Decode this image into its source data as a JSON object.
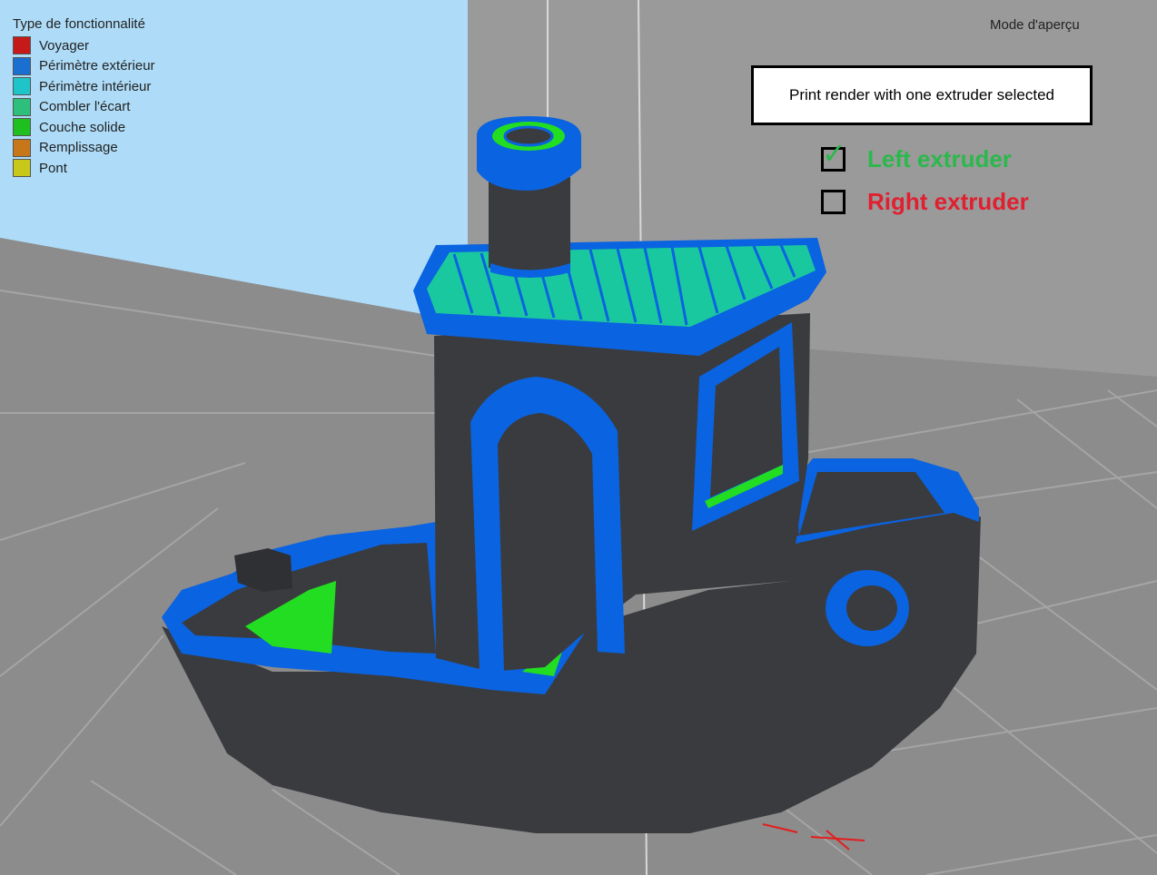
{
  "legend": {
    "title": "Type de fonctionnalité",
    "items": [
      {
        "label": "Voyager",
        "color": "#c41a1a"
      },
      {
        "label": "Périmètre extérieur",
        "color": "#1a6fd0"
      },
      {
        "label": "Périmètre intérieur",
        "color": "#1fc4c8"
      },
      {
        "label": "Combler l'écart",
        "color": "#2fbf7c"
      },
      {
        "label": "Couche solide",
        "color": "#1fbf1f"
      },
      {
        "label": "Remplissage",
        "color": "#c8761a"
      },
      {
        "label": "Pont",
        "color": "#c8c81a"
      }
    ]
  },
  "mode_label": "Mode d'aperçu",
  "annotation": {
    "note": "Print render with one extruder selected",
    "extruders": [
      {
        "label": "Left extruder",
        "checked": true,
        "color": "#2bb84c"
      },
      {
        "label": "Right extruder",
        "checked": false,
        "color": "#e02030"
      }
    ]
  },
  "model": {
    "body_color": "#3a3b3e",
    "perimeter_color": "#0a63e0",
    "solid_color": "#22dd22"
  }
}
